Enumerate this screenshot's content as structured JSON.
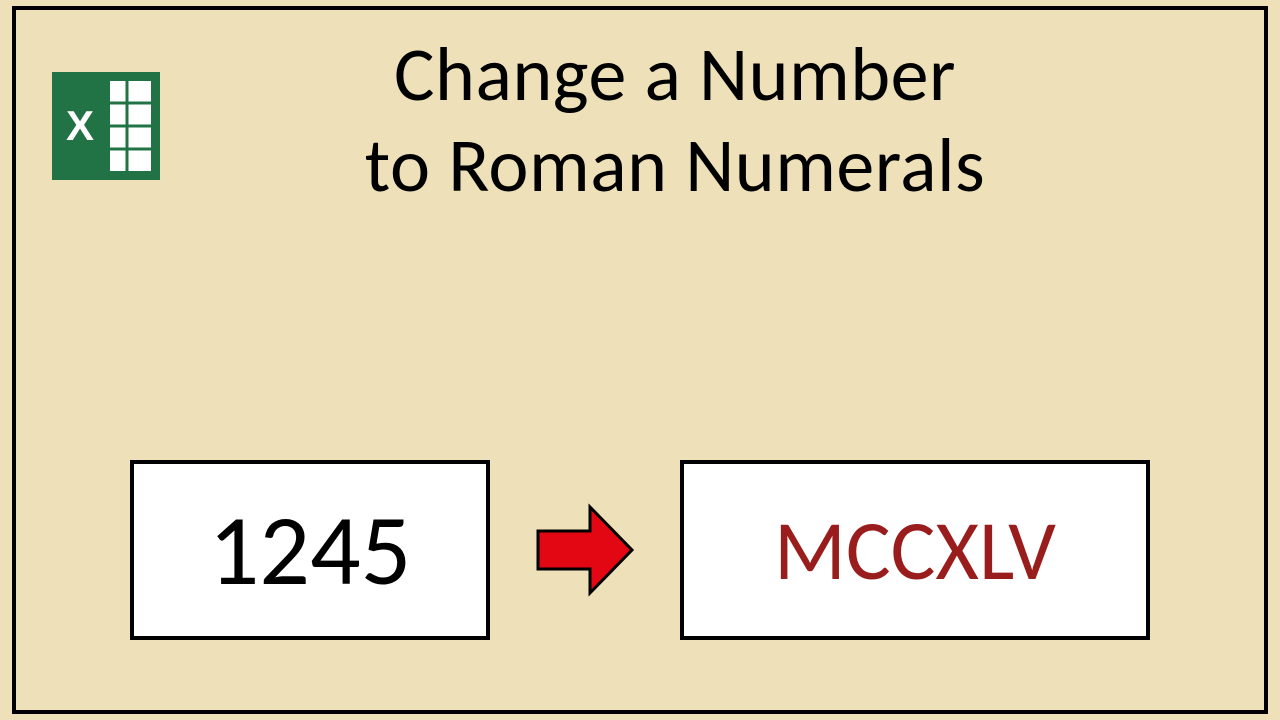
{
  "title": {
    "line1": "Change a Number",
    "line2": "to Roman Numerals"
  },
  "conversion": {
    "input_number": "1245",
    "output_roman": "MCCXLV"
  },
  "icons": {
    "app": "excel-icon",
    "arrow": "right-arrow-icon"
  },
  "colors": {
    "background": "#eee1b9",
    "border": "#000000",
    "roman_text": "#9a1d1d",
    "arrow_fill": "#e30613",
    "excel_green": "#217346"
  }
}
